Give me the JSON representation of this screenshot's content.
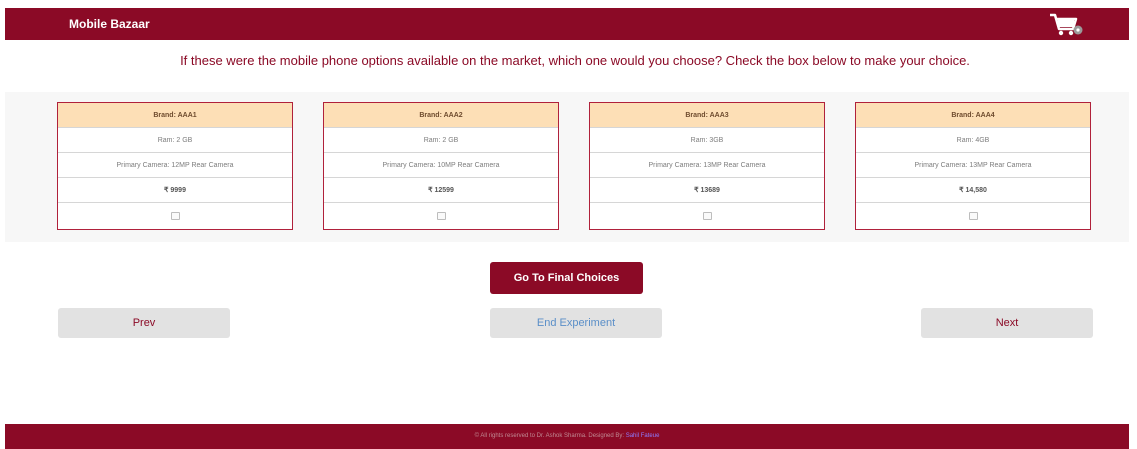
{
  "header": {
    "title": "Mobile Bazaar",
    "cart_icon": "cart-icon"
  },
  "question": "If these were the mobile phone options available on the market, which one would you choose? Check the box below to make your choice.",
  "cards": [
    {
      "brand": "Brand: AAA1",
      "ram": "Ram: 2 GB",
      "camera": "Primary Camera: 12MP Rear Camera",
      "price": "₹ 9999",
      "checked": false
    },
    {
      "brand": "Brand: AAA2",
      "ram": "Ram: 2 GB",
      "camera": "Primary Camera: 10MP Rear Camera",
      "price": "₹ 12599",
      "checked": false
    },
    {
      "brand": "Brand: AAA3",
      "ram": "Ram: 3GB",
      "camera": "Primary Camera: 13MP Rear Camera",
      "price": "₹ 13689",
      "checked": false
    },
    {
      "brand": "Brand: AAA4",
      "ram": "Ram: 4GB",
      "camera": "Primary Camera: 13MP Rear Camera",
      "price": "₹ 14,580",
      "checked": false
    }
  ],
  "buttons": {
    "final": "Go To Final Choices",
    "prev": "Prev",
    "end": "End Experiment",
    "next": "Next"
  },
  "footer": {
    "text": "© All rights reserved to Dr. Ashok Sharma. Designed By: ",
    "designer": "Sahil Fateue"
  },
  "colors": {
    "brand": "#8b0a26",
    "card_header": "#fddfb6",
    "button_grey": "#e2e2e2"
  }
}
